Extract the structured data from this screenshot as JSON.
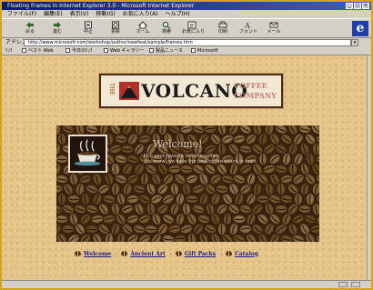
{
  "window": {
    "title": "Floating Frames in Internet Explorer 3.0 - Microsoft Internet Explorer"
  },
  "menu": [
    "ファイル(F)",
    "編集(E)",
    "表示(V)",
    "移動(G)",
    "お気に入り(A)",
    "ヘルプ(H)"
  ],
  "toolbar": {
    "buttons": [
      {
        "label": "戻る",
        "icon": "back-arrow-icon"
      },
      {
        "label": "進む",
        "icon": "forward-arrow-icon"
      },
      {
        "label": "中止",
        "icon": "stop-icon"
      },
      {
        "label": "更新",
        "icon": "refresh-icon"
      },
      {
        "label": "ホーム",
        "icon": "home-icon"
      },
      {
        "label": "検索",
        "icon": "search-icon"
      },
      {
        "label": "お気に入り",
        "icon": "favorites-icon"
      },
      {
        "label": "印刷",
        "icon": "print-icon"
      },
      {
        "label": "フォント",
        "icon": "font-icon"
      },
      {
        "label": "メール",
        "icon": "mail-icon"
      }
    ]
  },
  "address": {
    "label": "アドレス",
    "url": "http://www.microsoft.com/workshop/author/newfeat/sample/frames.htm"
  },
  "links": [
    "ﾘﾝｸ",
    "ベスト Web",
    "今日のﾘﾝｸ",
    "Web ギャラリー",
    "製品ニュース",
    "Microsoft"
  ],
  "page": {
    "logo": {
      "the": "THE",
      "brand": "VOLCANO",
      "sub_line1": "COFFEE",
      "sub_line2": "COMPANY"
    },
    "welcome_title": "Welcome!",
    "tagline_line1": "Pick your favorite Volcano coffee.",
    "tagline_line2": "You know, we have the best coffee beans in town.",
    "nav": [
      "Welcome",
      "Ancient Art",
      "Gift Packs",
      "Catalog"
    ]
  },
  "colors": {
    "background": "#e6c58a",
    "beans": "#3a220f",
    "link": "#1b1b8a",
    "frame": "#d9a019"
  }
}
